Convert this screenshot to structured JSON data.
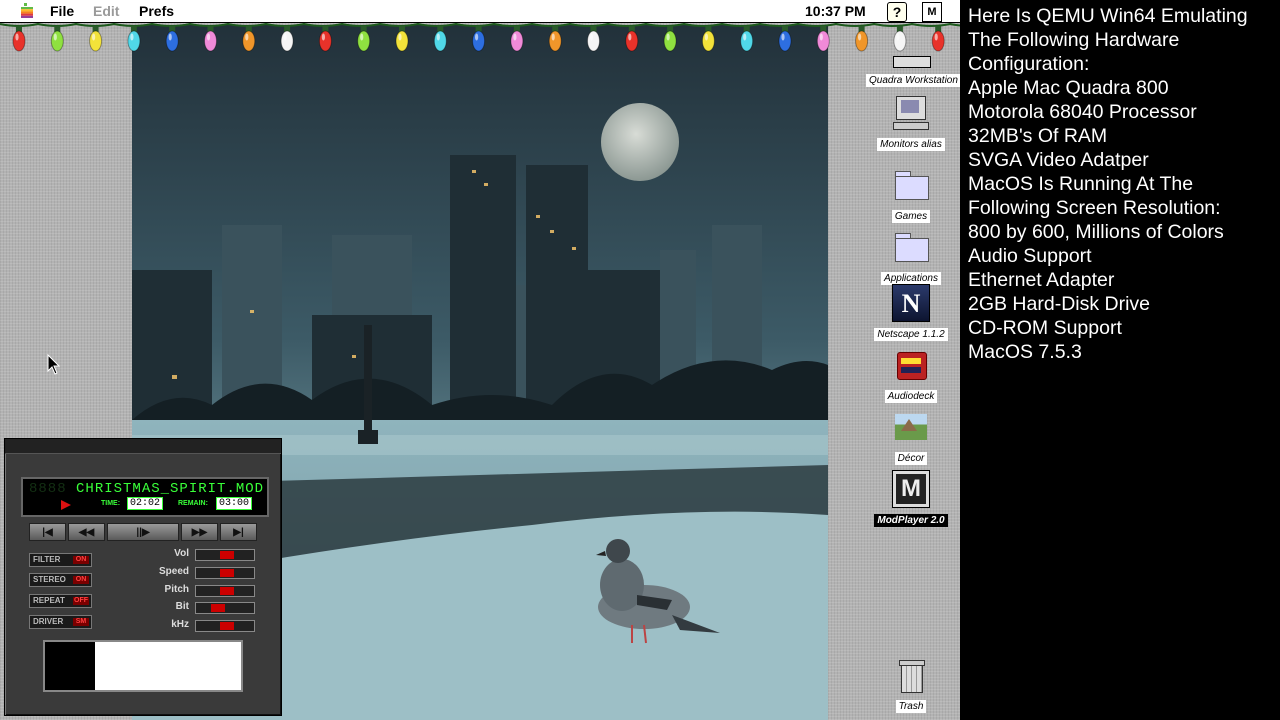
{
  "menubar": {
    "menus": [
      {
        "label": "File",
        "enabled": true
      },
      {
        "label": "Edit",
        "enabled": false
      },
      {
        "label": "Prefs",
        "enabled": true
      }
    ],
    "clock": "10:37 PM",
    "help_icon": "?",
    "app_icon": "M"
  },
  "lights": {
    "colors": [
      "#e8322a",
      "#8fe040",
      "#f2e23a",
      "#50d8e8",
      "#2d6ee0",
      "#f08ad8",
      "#f0962a",
      "#f5f5f5"
    ]
  },
  "desktop_icons": [
    {
      "label": "Quadra Workstation",
      "icon": "hard-disk-icon"
    },
    {
      "label": "Monitors alias",
      "icon": "monitor-icon"
    },
    {
      "label": "Games",
      "icon": "folder-icon"
    },
    {
      "label": "Applications",
      "icon": "folder-icon"
    },
    {
      "label": "Netscape 1.1.2",
      "icon": "netscape-icon"
    },
    {
      "label": "Audiodeck",
      "icon": "audiodeck-icon"
    },
    {
      "label": "Décor",
      "icon": "decor-icon"
    },
    {
      "label": "ModPlayer 2.0",
      "icon": "modplayer-icon"
    },
    {
      "label": "Trash",
      "icon": "trash-icon"
    }
  ],
  "player": {
    "led_prefix": "8888",
    "track": "CHRISTMAS_SPIRIT.MOD",
    "time_label": "TIME:",
    "time_value": "02:02",
    "remain_label": "REMAIN:",
    "remain_value": "03:00",
    "transport": [
      "|◀",
      "◀◀",
      "||▶",
      "▶▶",
      "▶|"
    ],
    "options": [
      {
        "label": "FILTER",
        "state": "ON"
      },
      {
        "label": "STEREO",
        "state": "ON"
      },
      {
        "label": "REPEAT",
        "state": "OFF"
      },
      {
        "label": "DRIVER",
        "state": "SM"
      }
    ],
    "params": [
      {
        "label": "Vol",
        "level": 0.55
      },
      {
        "label": "Speed",
        "level": 0.55
      },
      {
        "label": "Pitch",
        "level": 0.55
      },
      {
        "label": "Bit",
        "level": 0.35
      },
      {
        "label": "kHz",
        "level": 0.55
      }
    ]
  },
  "info": {
    "lines": [
      "Here Is QEMU Win64 Emulating",
      "The  Following Hardware",
      "Configuration:",
      "Apple Mac Quadra 800",
      "Motorola 68040 Processor",
      "32MB's Of RAM",
      "SVGA Video Adatper",
      "MacOS Is Running At The",
      "Following Screen Resolution:",
      "800 by 600, Millions of Colors",
      "Audio Support",
      "Ethernet Adapter",
      "2GB Hard-Disk Drive",
      "CD-ROM Support",
      "MacOS 7.5.3"
    ]
  }
}
